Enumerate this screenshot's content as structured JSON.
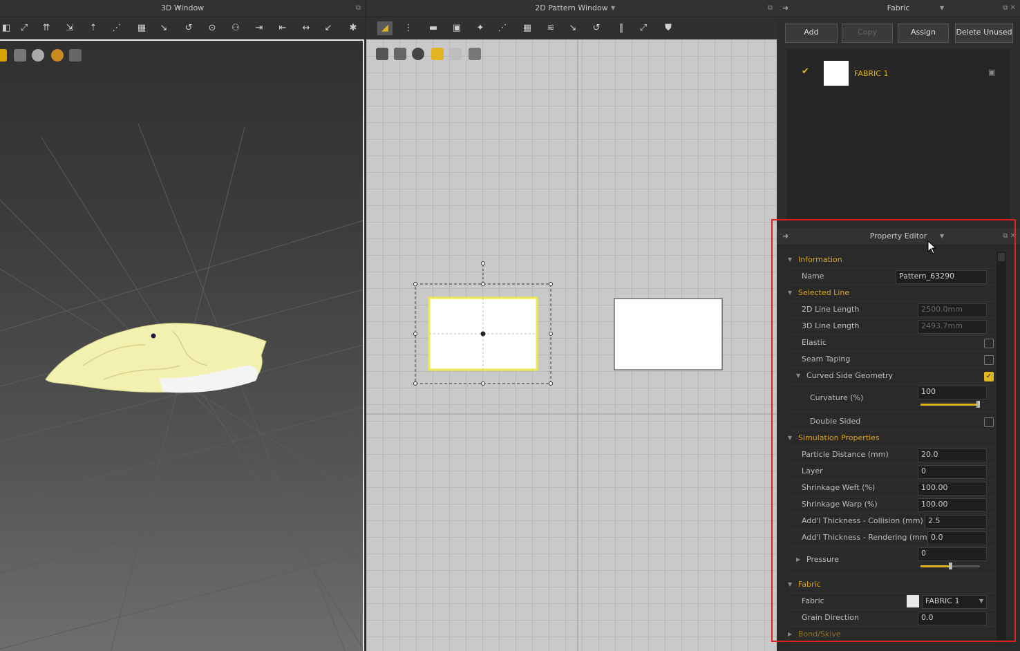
{
  "window3d": {
    "title": "3D Window"
  },
  "window2d": {
    "title": "2D Pattern Window"
  },
  "fabric_panel": {
    "title": "Fabric",
    "buttons": {
      "add": "Add",
      "copy": "Copy",
      "assign": "Assign",
      "delete_unused": "Delete Unused"
    },
    "items": [
      {
        "name": "FABRIC 1"
      }
    ]
  },
  "property_editor": {
    "title": "Property Editor",
    "information": {
      "section": "Information",
      "name_label": "Name",
      "name_value": "Pattern_63290"
    },
    "selected_line": {
      "section": "Selected Line",
      "line2d_label": "2D Line Length",
      "line2d_value": "2500.0mm",
      "line3d_label": "3D Line Length",
      "line3d_value": "2493.7mm",
      "elastic_label": "Elastic",
      "elastic": false,
      "seam_label": "Seam Taping",
      "seam": false,
      "curved_label": "Curved Side Geometry",
      "curved": true,
      "curvature_label": "Curvature (%)",
      "curvature_value": "100",
      "curvature_fraction": 1.0,
      "double_label": "Double Sided",
      "double": false
    },
    "simulation": {
      "section": "Simulation Properties",
      "rows": [
        {
          "label": "Particle Distance (mm)",
          "value": "20.0"
        },
        {
          "label": "Layer",
          "value": "0"
        },
        {
          "label": "Shrinkage Weft (%)",
          "value": "100.00"
        },
        {
          "label": "Shrinkage Warp (%)",
          "value": "100.00"
        },
        {
          "label": "Add'l Thickness - Collision (mm)",
          "value": "2.5"
        },
        {
          "label": "Add'l Thickness - Rendering (mm)",
          "value": "0.0"
        }
      ],
      "pressure_label": "Pressure",
      "pressure_value": "0",
      "pressure_fraction": 0.5
    },
    "fabric": {
      "section": "Fabric",
      "fabric_label": "Fabric",
      "fabric_value": "FABRIC 1",
      "grain_label": "Grain Direction",
      "grain_value": "0.0"
    },
    "bond_section": "Bond/Skive"
  },
  "colors": {
    "accent": "#e0b520",
    "highlight_red": "#e02020",
    "cloth": "#f3f1b0"
  }
}
